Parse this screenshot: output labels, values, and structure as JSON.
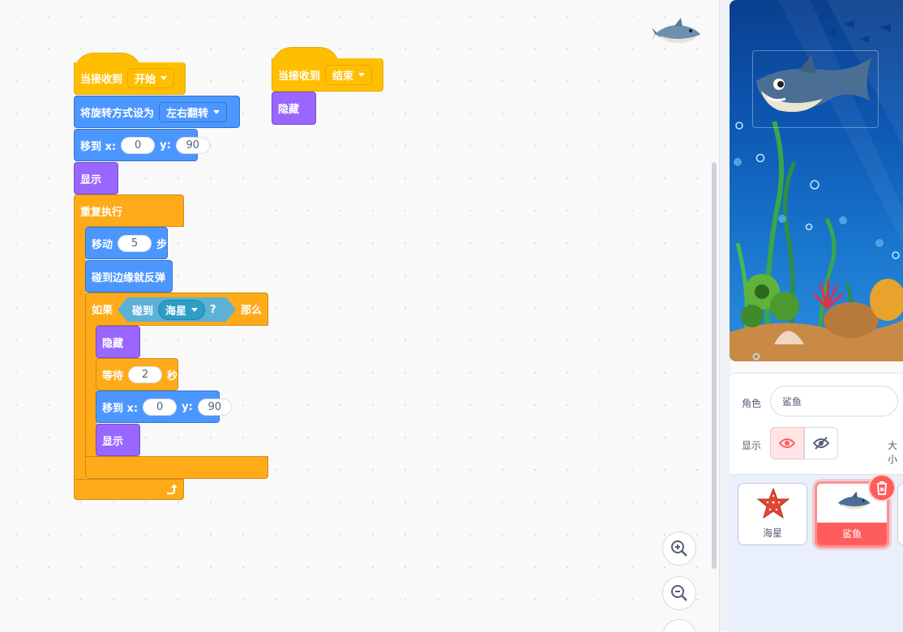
{
  "scripts": {
    "start": {
      "hat_label": "当接收到",
      "hat_message": "开始",
      "rotation_label": "将旋转方式设为",
      "rotation_value": "左右翻转",
      "goto1": {
        "label": "移到 x:",
        "x": "0",
        "ylabel": "y:",
        "y": "90"
      },
      "show1": "显示",
      "forever": "重复执行",
      "move": {
        "label": "移动",
        "steps": "5",
        "unit": "步"
      },
      "bounce": "碰到边缘就反弹",
      "if": {
        "label": "如果",
        "then": "那么"
      },
      "touching": {
        "label": "碰到",
        "target": "海星",
        "q": "?"
      },
      "hide": "隐藏",
      "wait": {
        "label": "等待",
        "secs": "2",
        "unit": "秒"
      },
      "goto2": {
        "label": "移到 x:",
        "x": "0",
        "ylabel": "y:",
        "y": "90"
      },
      "show2": "显示"
    },
    "end": {
      "hat_label": "当接收到",
      "hat_message": "结束",
      "hide": "隐藏"
    }
  },
  "icons": {
    "zoom_in": "zoom-in-icon",
    "zoom_out": "zoom-out-icon",
    "loop_arrow": "loop-arrow-icon",
    "show": "eye-icon",
    "hide": "eye-off-icon",
    "delete": "trash-icon"
  },
  "sprite_info": {
    "sprite_label": "角色",
    "sprite_name": "鲨鱼",
    "show_label": "显示",
    "size_label": "大小"
  },
  "sprites": [
    {
      "name": "海星",
      "selected": false
    },
    {
      "name": "鲨鱼",
      "selected": true
    }
  ],
  "colors": {
    "events": "#ffbf00",
    "motion": "#4c97ff",
    "looks": "#9966ff",
    "control": "#ffab19",
    "sensing": "#5cb1d6",
    "selected_sprite": "#ff5c5c"
  }
}
